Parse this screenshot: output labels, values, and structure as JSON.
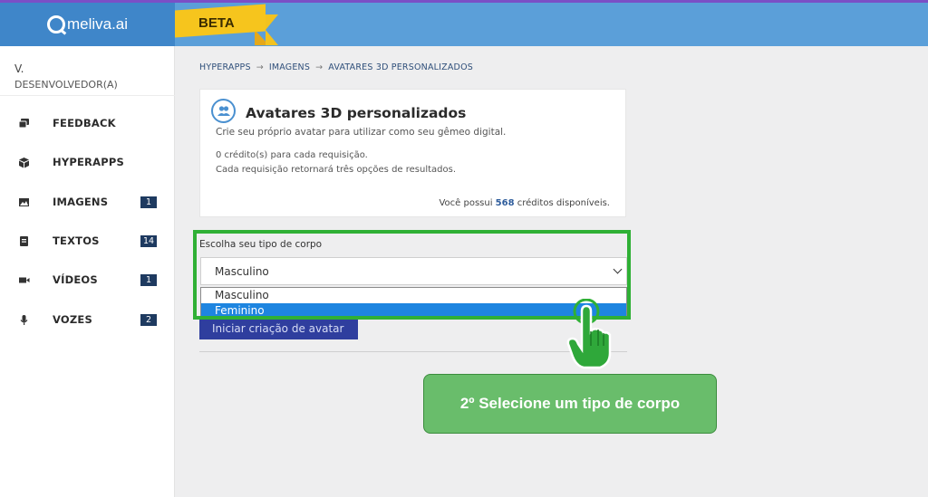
{
  "header": {
    "logo_text": "meliva.ai",
    "beta_label": "BETA",
    "colors": {
      "topline": "#7b4fc6",
      "header": "#5b9fd9",
      "logo_bg": "#3f86c9",
      "beta": "#f6c51d"
    }
  },
  "sidebar": {
    "user_name": "V.",
    "user_role": "DESENVOLVEDOR(A)",
    "items": [
      {
        "label": "FEEDBACK",
        "icon": "chat-icon",
        "badge": ""
      },
      {
        "label": "HYPERAPPS",
        "icon": "cube-icon",
        "badge": ""
      },
      {
        "label": "IMAGENS",
        "icon": "image-icon",
        "badge": "1"
      },
      {
        "label": "TEXTOS",
        "icon": "document-icon",
        "badge": "14"
      },
      {
        "label": "VÍDEOS",
        "icon": "video-camera-icon",
        "badge": "1"
      },
      {
        "label": "VOZES",
        "icon": "microphone-icon",
        "badge": "2"
      }
    ]
  },
  "breadcrumb": {
    "items": [
      "HYPERAPPS",
      "IMAGENS",
      "AVATARES 3D PERSONALIZADOS"
    ],
    "separator": "→"
  },
  "card": {
    "icon": "users-icon",
    "title": "Avatares 3D personalizados",
    "subtitle": "Crie seu próprio avatar para utilizar como seu gêmeo digital.",
    "credit_line1": "0 crédito(s) para cada requisição.",
    "credit_line2": "Cada requisição retornará três opções de resultados.",
    "avail_prefix": "Você possui",
    "avail_count": "568",
    "avail_suffix": "créditos disponíveis."
  },
  "form": {
    "label": "Escolha seu tipo de corpo",
    "selected_value": "Masculino",
    "options": [
      "Masculino",
      "Feminino"
    ],
    "highlighted_option": "Feminino",
    "start_button": "Iniciar criação de avatar"
  },
  "callout": {
    "text": "2º Selecione um tipo de corpo",
    "color": "#69bd6b"
  }
}
